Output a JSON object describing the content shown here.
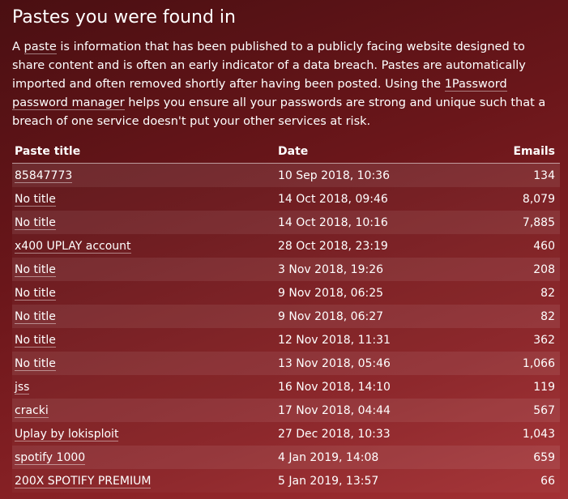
{
  "heading": "Pastes you were found in",
  "intro": {
    "part1": "A ",
    "paste_link": "paste",
    "part2": " is information that has been published to a publicly facing website designed to share content and is often an early indicator of a data breach. Pastes are automatically imported and often removed shortly after having been posted. Using the ",
    "pm_link": "1Password password manager",
    "part3": " helps you ensure all your passwords are strong and unique such that a breach of one service doesn't put your other services at risk."
  },
  "table": {
    "headers": {
      "title": "Paste title",
      "date": "Date",
      "emails": "Emails"
    },
    "rows": [
      {
        "title": "85847773",
        "date": "10 Sep 2018, 10:36",
        "emails": "134"
      },
      {
        "title": "No title",
        "date": "14 Oct 2018, 09:46",
        "emails": "8,079"
      },
      {
        "title": "No title",
        "date": "14 Oct 2018, 10:16",
        "emails": "7,885"
      },
      {
        "title": "x400 UPLAY account",
        "date": "28 Oct 2018, 23:19",
        "emails": "460"
      },
      {
        "title": "No title",
        "date": "3 Nov 2018, 19:26",
        "emails": "208"
      },
      {
        "title": "No title",
        "date": "9 Nov 2018, 06:25",
        "emails": "82"
      },
      {
        "title": "No title",
        "date": "9 Nov 2018, 06:27",
        "emails": "82"
      },
      {
        "title": "No title",
        "date": "12 Nov 2018, 11:31",
        "emails": "362"
      },
      {
        "title": "No title",
        "date": "13 Nov 2018, 05:46",
        "emails": "1,066"
      },
      {
        "title": "jss",
        "date": "16 Nov 2018, 14:10",
        "emails": "119"
      },
      {
        "title": "cracki",
        "date": "17 Nov 2018, 04:44",
        "emails": "567"
      },
      {
        "title": "Uplay by lokisploit",
        "date": "27 Dec 2018, 10:33",
        "emails": "1,043"
      },
      {
        "title": "spotify 1000",
        "date": "4 Jan 2019, 14:08",
        "emails": "659"
      },
      {
        "title": "200X SPOTIFY PREMIUM",
        "date": "5 Jan 2019, 13:57",
        "emails": "66"
      }
    ]
  }
}
